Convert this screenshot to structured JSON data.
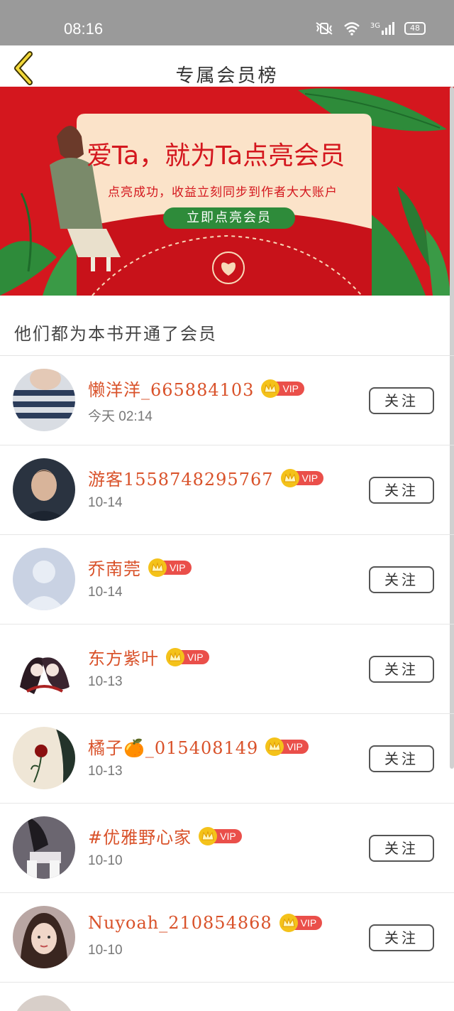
{
  "status_bar": {
    "time": "08:16",
    "network": "3G",
    "battery": "48"
  },
  "header": {
    "title": "专属会员榜"
  },
  "banner": {
    "headline": "爱Ta，就为Ta点亮会员",
    "subline": "点亮成功，收益立刻同步到作者大大账户",
    "button_label": "立即点亮会员"
  },
  "section": {
    "label": "他们都为本书开通了会员"
  },
  "vip_label": "VIP",
  "follow_label": "关注",
  "members": [
    {
      "name": "懒洋洋_665884103",
      "date": "今天 02:14",
      "avatar": "striped-shirt"
    },
    {
      "name": "游客1558748295767",
      "date": "10-14",
      "avatar": "young-man"
    },
    {
      "name": "乔南莞",
      "date": "10-14",
      "avatar": "default-silhouette"
    },
    {
      "name": "东方紫叶",
      "date": "10-13",
      "avatar": "anime-pair"
    },
    {
      "name": "橘子🍊_015408149",
      "date": "10-13",
      "avatar": "rose"
    },
    {
      "name": "#优雅野心家",
      "date": "10-10",
      "avatar": "girl-sitting"
    },
    {
      "name": "Nuyoah_210854868",
      "date": "10-10",
      "avatar": "girl-portrait"
    }
  ],
  "colors": {
    "accent": "#d9522a",
    "vip_red": "#ea4f4a",
    "crown_gold": "#f4c21a",
    "banner_red": "#d4171e",
    "banner_green": "#2e8b3a"
  }
}
